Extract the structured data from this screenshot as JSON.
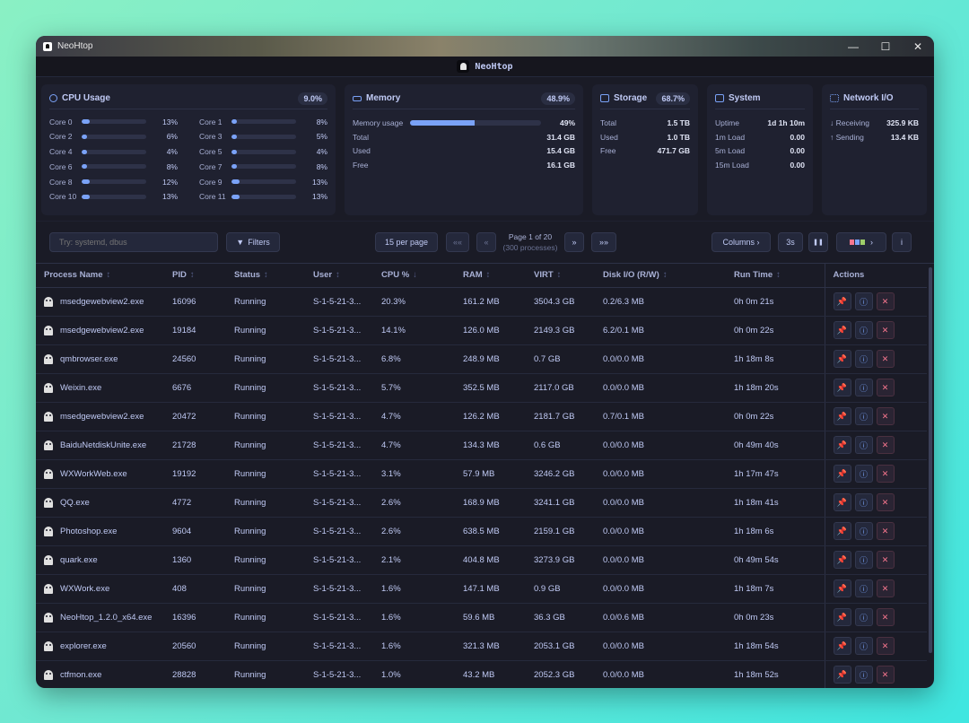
{
  "window": {
    "title": "NeoHtop"
  },
  "header": {
    "title": "NeoHtop"
  },
  "cpu": {
    "title": "CPU Usage",
    "total": "9.0%",
    "cores": [
      {
        "label": "Core 0",
        "pct": "13%",
        "value": 13
      },
      {
        "label": "Core 1",
        "pct": "8%",
        "value": 8
      },
      {
        "label": "Core 2",
        "pct": "6%",
        "value": 6
      },
      {
        "label": "Core 3",
        "pct": "5%",
        "value": 5
      },
      {
        "label": "Core 4",
        "pct": "4%",
        "value": 4
      },
      {
        "label": "Core 5",
        "pct": "4%",
        "value": 4
      },
      {
        "label": "Core 6",
        "pct": "8%",
        "value": 8
      },
      {
        "label": "Core 7",
        "pct": "8%",
        "value": 8
      },
      {
        "label": "Core 8",
        "pct": "12%",
        "value": 12
      },
      {
        "label": "Core 9",
        "pct": "13%",
        "value": 13
      },
      {
        "label": "Core 10",
        "pct": "13%",
        "value": 13
      },
      {
        "label": "Core 11",
        "pct": "13%",
        "value": 13
      }
    ]
  },
  "memory": {
    "title": "Memory",
    "total_pct": "48.9%",
    "usage_label": "Memory usage",
    "usage_pct": "49%",
    "usage_value": 49,
    "rows": [
      {
        "k": "Total",
        "v": "31.4 GB"
      },
      {
        "k": "Used",
        "v": "15.4 GB"
      },
      {
        "k": "Free",
        "v": "16.1 GB"
      }
    ]
  },
  "storage": {
    "title": "Storage",
    "pct": "68.7%",
    "rows": [
      {
        "k": "Total",
        "v": "1.5 TB"
      },
      {
        "k": "Used",
        "v": "1.0 TB"
      },
      {
        "k": "Free",
        "v": "471.7 GB"
      }
    ]
  },
  "system": {
    "title": "System",
    "rows": [
      {
        "k": "Uptime",
        "v": "1d 1h 10m"
      },
      {
        "k": "1m Load",
        "v": "0.00"
      },
      {
        "k": "5m Load",
        "v": "0.00"
      },
      {
        "k": "15m Load",
        "v": "0.00"
      }
    ]
  },
  "network": {
    "title": "Network I/O",
    "rows": [
      {
        "k": "↓ Receiving",
        "v": "325.9 KB"
      },
      {
        "k": "↑ Sending",
        "v": "13.4 KB"
      }
    ]
  },
  "toolbar": {
    "search_placeholder": "Try: systemd, dbus",
    "filters": "Filters",
    "per_page": "15 per page",
    "first": "««",
    "prev": "«",
    "page_info": "Page 1 of 20",
    "page_sub": "(300 processes)",
    "next": "»",
    "last": "»»",
    "columns": "Columns ›",
    "refresh": "3s",
    "pause": "❚❚",
    "info": "i"
  },
  "table": {
    "headers": [
      "Process Name",
      "PID",
      "Status",
      "User",
      "CPU %",
      "RAM",
      "VIRT",
      "Disk I/O (R/W)",
      "Run Time",
      "Actions"
    ],
    "rows": [
      [
        "msedgewebview2.exe",
        "16096",
        "Running",
        "S-1-5-21-3...",
        "20.3%",
        "161.2 MB",
        "3504.3 GB",
        "0.2/6.3 MB",
        "0h 0m 21s"
      ],
      [
        "msedgewebview2.exe",
        "19184",
        "Running",
        "S-1-5-21-3...",
        "14.1%",
        "126.0 MB",
        "2149.3 GB",
        "6.2/0.1 MB",
        "0h 0m 22s"
      ],
      [
        "qmbrowser.exe",
        "24560",
        "Running",
        "S-1-5-21-3...",
        "6.8%",
        "248.9 MB",
        "0.7 GB",
        "0.0/0.0 MB",
        "1h 18m 8s"
      ],
      [
        "Weixin.exe",
        "6676",
        "Running",
        "S-1-5-21-3...",
        "5.7%",
        "352.5 MB",
        "2117.0 GB",
        "0.0/0.0 MB",
        "1h 18m 20s"
      ],
      [
        "msedgewebview2.exe",
        "20472",
        "Running",
        "S-1-5-21-3...",
        "4.7%",
        "126.2 MB",
        "2181.7 GB",
        "0.7/0.1 MB",
        "0h 0m 22s"
      ],
      [
        "BaiduNetdiskUnite.exe",
        "21728",
        "Running",
        "S-1-5-21-3...",
        "4.7%",
        "134.3 MB",
        "0.6 GB",
        "0.0/0.0 MB",
        "0h 49m 40s"
      ],
      [
        "WXWorkWeb.exe",
        "19192",
        "Running",
        "S-1-5-21-3...",
        "3.1%",
        "57.9 MB",
        "3246.2 GB",
        "0.0/0.0 MB",
        "1h 17m 47s"
      ],
      [
        "QQ.exe",
        "4772",
        "Running",
        "S-1-5-21-3...",
        "2.6%",
        "168.9 MB",
        "3241.1 GB",
        "0.0/0.0 MB",
        "1h 18m 41s"
      ],
      [
        "Photoshop.exe",
        "9604",
        "Running",
        "S-1-5-21-3...",
        "2.6%",
        "638.5 MB",
        "2159.1 GB",
        "0.0/0.0 MB",
        "1h 18m 6s"
      ],
      [
        "quark.exe",
        "1360",
        "Running",
        "S-1-5-21-3...",
        "2.1%",
        "404.8 MB",
        "3273.9 GB",
        "0.0/0.0 MB",
        "0h 49m 54s"
      ],
      [
        "WXWork.exe",
        "408",
        "Running",
        "S-1-5-21-3...",
        "1.6%",
        "147.1 MB",
        "0.9 GB",
        "0.0/0.0 MB",
        "1h 18m 7s"
      ],
      [
        "NeoHtop_1.2.0_x64.exe",
        "16396",
        "Running",
        "S-1-5-21-3...",
        "1.6%",
        "59.6 MB",
        "36.3 GB",
        "0.0/0.6 MB",
        "0h 0m 23s"
      ],
      [
        "explorer.exe",
        "20560",
        "Running",
        "S-1-5-21-3...",
        "1.6%",
        "321.3 MB",
        "2053.1 GB",
        "0.0/0.0 MB",
        "1h 18m 54s"
      ],
      [
        "ctfmon.exe",
        "28828",
        "Running",
        "S-1-5-21-3...",
        "1.0%",
        "43.2 MB",
        "2052.3 GB",
        "0.0/0.0 MB",
        "1h 18m 52s"
      ]
    ]
  }
}
